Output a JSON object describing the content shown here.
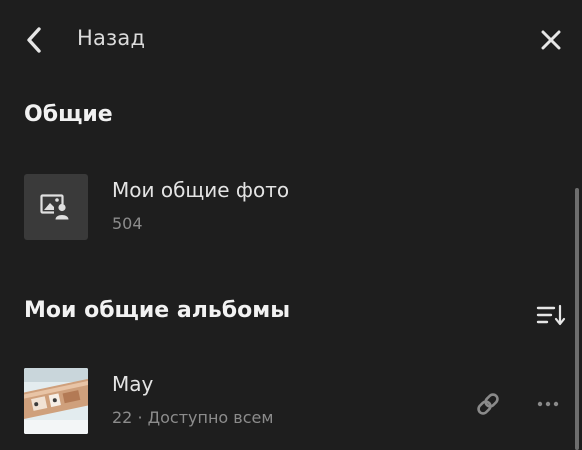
{
  "header": {
    "back_label": "Назад",
    "back_icon": "chevron-left-icon",
    "close_icon": "close-icon"
  },
  "shared_section": {
    "title": "Общие",
    "item": {
      "title": "Мои общие фото",
      "count": "504",
      "icon": "shared-photo-icon"
    }
  },
  "albums_section": {
    "title": "Мои общие альбомы",
    "sort_icon": "sort-icon",
    "albums": [
      {
        "title": "May",
        "subtitle": "22 · Доступно всем",
        "link_icon": "link-icon",
        "more_icon": "more-icon"
      }
    ]
  },
  "colors": {
    "background": "#1e1e1e",
    "placeholder": "#3a3a3a",
    "text_primary": "#e4e4e4",
    "text_secondary": "#8c8c8c"
  }
}
